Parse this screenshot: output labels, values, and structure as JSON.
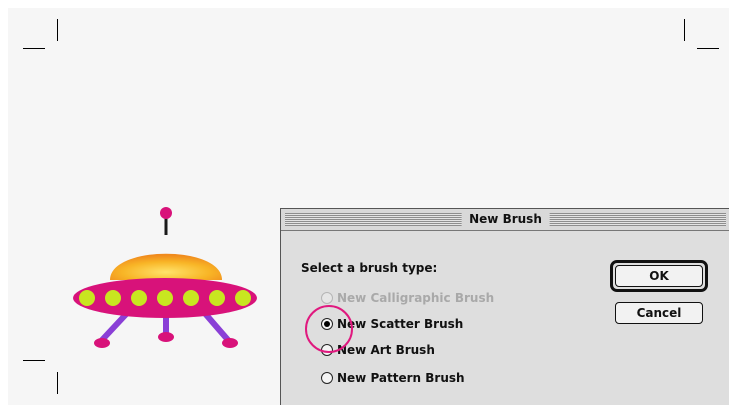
{
  "dialog": {
    "title": "New Brush",
    "prompt": "Select a brush type:",
    "options": [
      {
        "label": "New Calligraphic Brush",
        "state": "disabled"
      },
      {
        "label": "New Scatter Brush",
        "state": "selected"
      },
      {
        "label": "New Art Brush",
        "state": "enabled"
      },
      {
        "label": "New Pattern Brush",
        "state": "enabled"
      }
    ],
    "ok_label": "OK",
    "cancel_label": "Cancel"
  },
  "colors": {
    "canvas_background": "#f6f6f6",
    "dialog_background": "#dedede",
    "highlight": "#e0197f",
    "ufo_saucer": "#d8127a",
    "ufo_dome": "#f7b825",
    "ufo_lights": "#c8e620",
    "ufo_legs": "#8a3fd6"
  },
  "artwork": {
    "icon": "ufo-spaceship-icon",
    "highlight_target": "radio-new-scatter-brush"
  }
}
